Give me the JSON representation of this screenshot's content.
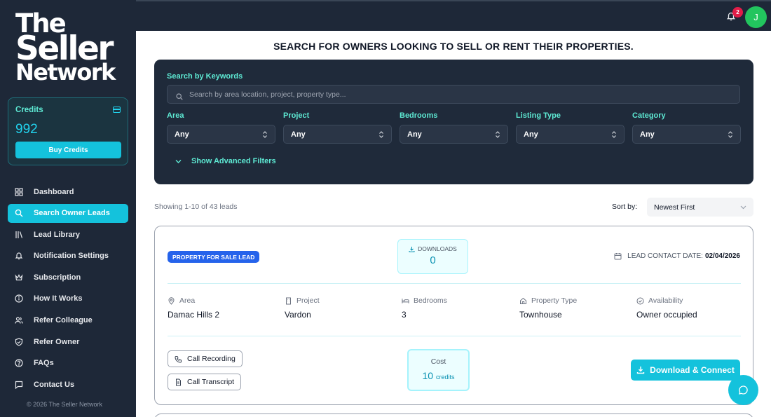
{
  "brand": {
    "line1": "The",
    "line2": "Seller",
    "line3": "Network"
  },
  "credits": {
    "label": "Credits",
    "value": "992",
    "buy_label": "Buy Credits"
  },
  "nav": [
    {
      "label": "Dashboard",
      "icon": "grid-icon",
      "active": false
    },
    {
      "label": "Search Owner Leads",
      "icon": "search-icon",
      "active": true
    },
    {
      "label": "Lead Library",
      "icon": "library-icon",
      "active": false
    },
    {
      "label": "Notification Settings",
      "icon": "bell-icon",
      "active": false
    },
    {
      "label": "Subscription",
      "icon": "crown-icon",
      "active": false
    },
    {
      "label": "How It Works",
      "icon": "info-icon",
      "active": false
    },
    {
      "label": "Refer Colleague",
      "icon": "users-icon",
      "active": false
    },
    {
      "label": "Refer Owner",
      "icon": "shield-icon",
      "active": false
    },
    {
      "label": "FAQs",
      "icon": "help-icon",
      "active": false
    },
    {
      "label": "Contact Us",
      "icon": "message-icon",
      "active": false
    }
  ],
  "copyright": "© 2026 The Seller Network",
  "topbar": {
    "notification_count": "2",
    "avatar_initial": "J"
  },
  "page_title": "SEARCH FOR OWNERS LOOKING TO SELL OR RENT THEIR PROPERTIES.",
  "search": {
    "keywords_label": "Search by Keywords",
    "keywords_placeholder": "Search by area location, project, property type...",
    "filters": [
      {
        "label": "Area",
        "value": "Any"
      },
      {
        "label": "Project",
        "value": "Any"
      },
      {
        "label": "Bedrooms",
        "value": "Any"
      },
      {
        "label": "Listing Type",
        "value": "Any"
      },
      {
        "label": "Category",
        "value": "Any"
      }
    ],
    "advanced_label": "Show Advanced Filters"
  },
  "results": {
    "showing": "Showing 1-10 of 43 leads",
    "sort_label": "Sort by:",
    "sort_value": "Newest First"
  },
  "lead": {
    "badge": "PROPERTY FOR SALE LEAD",
    "downloads_label": "DOWNLOADS",
    "downloads_value": "0",
    "contact_date_label": "LEAD CONTACT DATE:",
    "contact_date_value": "02/04/2026",
    "attributes": [
      {
        "label": "Area",
        "value": "Damac Hills 2",
        "icon": "pin-icon"
      },
      {
        "label": "Project",
        "value": "Vardon",
        "icon": "building-icon"
      },
      {
        "label": "Bedrooms",
        "value": "3",
        "icon": "bed-icon"
      },
      {
        "label": "Property Type",
        "value": "Townhouse",
        "icon": "home-icon"
      },
      {
        "label": "Availability",
        "value": "Owner occupied",
        "icon": "check-circle-icon"
      }
    ],
    "call_recording_label": "Call Recording",
    "call_transcript_label": "Call Transcript",
    "cost_label": "Cost",
    "cost_value": "10",
    "cost_unit": "credits",
    "download_label": "Download & Connect"
  }
}
